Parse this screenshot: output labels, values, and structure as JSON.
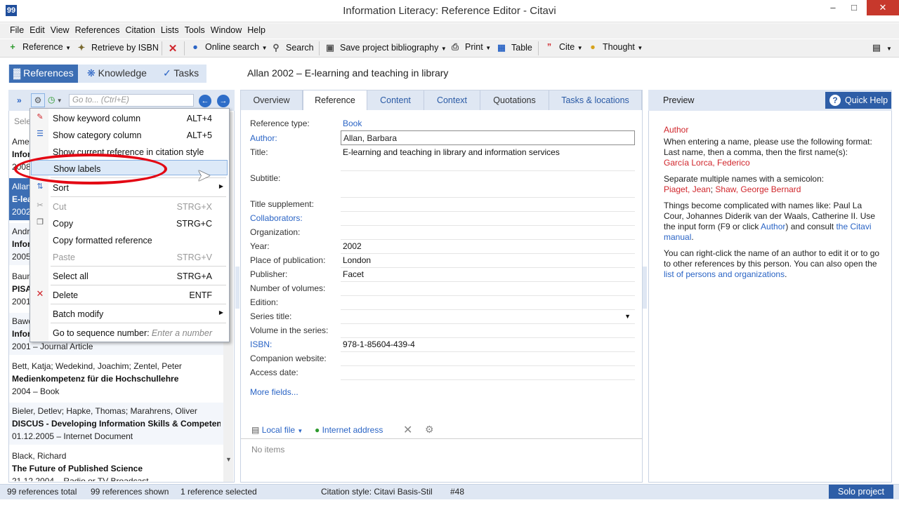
{
  "window": {
    "title": "Information Literacy: Reference Editor - Citavi",
    "app_icon": "99"
  },
  "menubar": [
    "File",
    "Edit",
    "View",
    "References",
    "Citation",
    "Lists",
    "Tools",
    "Window",
    "Help"
  ],
  "toolbar": {
    "reference": "Reference",
    "retrieve": "Retrieve by ISBN",
    "online_search": "Online search",
    "search": "Search",
    "save_bib": "Save project bibliography",
    "print": "Print",
    "table": "Table",
    "cite": "Cite",
    "thought": "Thought"
  },
  "nav": {
    "references": "References",
    "knowledge": "Knowledge",
    "tasks": "Tasks"
  },
  "current_reference": "Allan 2002 – E-learning and teaching in library",
  "left": {
    "goto_placeholder": "Go to... (Ctrl+E)",
    "select_partial": "Sele",
    "items": [
      {
        "authors": "Ame",
        "title": "Infor",
        "meta": "2008"
      },
      {
        "authors": "Allan",
        "title": "E-lea",
        "meta": "2002"
      },
      {
        "authors": "Andr",
        "title": "Infor",
        "meta": "2005"
      },
      {
        "authors": "Baum",
        "title": "PISA",
        "meta": "2001"
      },
      {
        "authors": "Bawd",
        "title": "Infor",
        "meta": "2001 – Journal Article"
      },
      {
        "authors": "Bett, Katja; Wedekind, Joachim; Zentel, Peter",
        "title": "Medienkompetenz für die Hochschullehre",
        "meta": "2004 – Book"
      },
      {
        "authors": "Bieler, Detlev; Hapke, Thomas; Marahrens, Oliver",
        "title": "DISCUS - Developing Information Skills & Competen",
        "meta": "01.12.2005 – Internet Document"
      },
      {
        "authors": "Black, Richard",
        "title": "The Future of Published Science",
        "meta": "21.12.2004 – Radio or TV Broadcast"
      }
    ]
  },
  "context_menu": {
    "items": [
      {
        "label": "Show keyword column",
        "shortcut": "ALT+4"
      },
      {
        "label": "Show category column",
        "shortcut": "ALT+5"
      },
      {
        "label": "Show current reference in citation style",
        "shortcut": ""
      },
      {
        "label": "Show labels",
        "shortcut": ""
      },
      {
        "label": "Sort",
        "shortcut": ""
      },
      {
        "label": "Cut",
        "shortcut": "STRG+X"
      },
      {
        "label": "Copy",
        "shortcut": "STRG+C"
      },
      {
        "label": "Copy formatted reference",
        "shortcut": ""
      },
      {
        "label": "Paste",
        "shortcut": "STRG+V"
      },
      {
        "label": "Select all",
        "shortcut": "STRG+A"
      },
      {
        "label": "Delete",
        "shortcut": "ENTF"
      },
      {
        "label": "Batch modify",
        "shortcut": ""
      },
      {
        "label": "Go to sequence number:",
        "shortcut": "Enter a number"
      }
    ]
  },
  "tabs": [
    "Overview",
    "Reference",
    "Content",
    "Context",
    "Quotations",
    "Tasks & locations"
  ],
  "fields": {
    "reference_type_label": "Reference type:",
    "reference_type": "Book",
    "author_label": "Author:",
    "author": "Allan, Barbara",
    "title_label": "Title:",
    "title": "E-learning and teaching in library and information services",
    "subtitle_label": "Subtitle:",
    "title_supplement_label": "Title supplement:",
    "collaborators_label": "Collaborators:",
    "organization_label": "Organization:",
    "year_label": "Year:",
    "year": "2002",
    "place_label": "Place of publication:",
    "place": "London",
    "publisher_label": "Publisher:",
    "publisher": "Facet",
    "volumes_label": "Number of volumes:",
    "edition_label": "Edition:",
    "series_label": "Series title:",
    "volume_series_label": "Volume in the series:",
    "isbn_label": "ISBN:",
    "isbn": "978-1-85604-439-4",
    "companion_label": "Companion website:",
    "access_label": "Access date:",
    "more_fields": "More fields...",
    "local_file": "Local file",
    "internet_address": "Internet address",
    "no_items": "No items"
  },
  "preview": {
    "header": "Preview",
    "quick_help": "Quick Help",
    "heading": "Author",
    "p1": "When entering a name, please use the following format: Last name, then a comma, then the first name(s):",
    "ex1": "García Lorca, Federico",
    "p2": "Separate multiple names with a semicolon:",
    "ex2a": "Piaget, Jean",
    "ex2sep": ";",
    "ex2b": "Shaw, George Bernard",
    "p3a": "Things become complicated with names like: Paul La Cour, Johannes Diderik van der Waals, Catherine II. Use the input form (F9 or click",
    "p3link": "Author",
    "p3b": ") and consult",
    "p3link2": "the Citavi manual",
    "p3c": ".",
    "p4": "You can right-click the name of an author to edit it or to go to other references by this person. You can also open the",
    "p4link": "list of persons and organizations",
    "p4end": "."
  },
  "status": {
    "total": "99 references total",
    "shown": "99 references shown",
    "selected": "1 reference selected",
    "style": "Citation style: Citavi Basis-Stil",
    "seq": "#48",
    "solo": "Solo project"
  }
}
